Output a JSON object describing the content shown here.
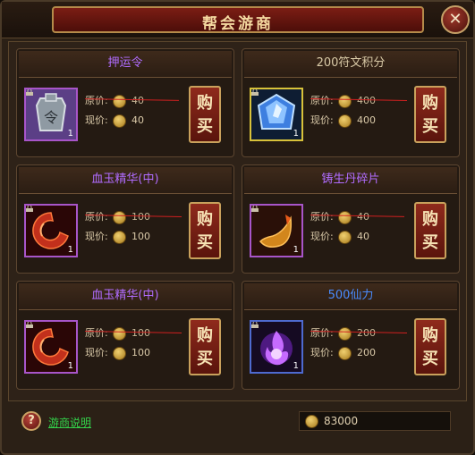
{
  "window": {
    "title": "帮会游商",
    "close_symbol": "✕"
  },
  "labels": {
    "original_price": "原价:",
    "current_price": "现价:",
    "buy": "购买"
  },
  "items": [
    {
      "name": "押运令",
      "name_color": "#b06cff",
      "icon": "token-icon",
      "quantity": "1",
      "original_price": "40",
      "current_price": "40"
    },
    {
      "name": "200符文积分",
      "name_color": "#d8c9a6",
      "icon": "rune-crystal-icon",
      "quantity": "1",
      "original_price": "400",
      "current_price": "400"
    },
    {
      "name": "血玉精华(中)",
      "name_color": "#b06cff",
      "icon": "blood-jade-icon",
      "quantity": "1",
      "original_price": "100",
      "current_price": "100"
    },
    {
      "name": "铸生丹碎片",
      "name_color": "#b06cff",
      "icon": "pill-fragment-icon",
      "quantity": "1",
      "original_price": "40",
      "current_price": "40"
    },
    {
      "name": "血玉精华(中)",
      "name_color": "#b06cff",
      "icon": "blood-jade-icon",
      "quantity": "1",
      "original_price": "100",
      "current_price": "100"
    },
    {
      "name": "500仙力",
      "name_color": "#4a8cff",
      "icon": "purple-flame-icon",
      "quantity": "1",
      "original_price": "200",
      "current_price": "200"
    }
  ],
  "footer": {
    "help_link": "游商说明",
    "gold": "83000"
  }
}
